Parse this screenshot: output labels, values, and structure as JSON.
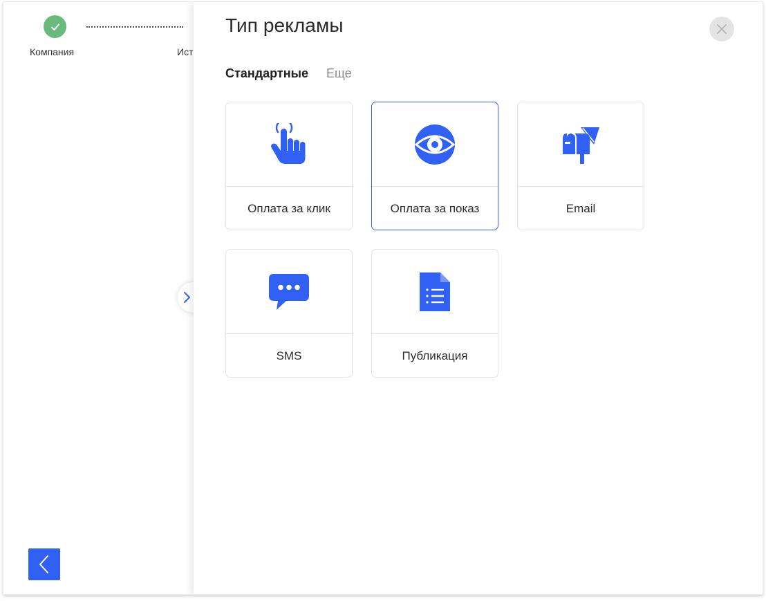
{
  "wizard": {
    "steps": [
      {
        "label": "Компания",
        "status": "done"
      },
      {
        "label": "Ист"
      }
    ]
  },
  "drawer": {
    "title": "Тип рекламы",
    "tabs": [
      {
        "label": "Стандартные",
        "active": true
      },
      {
        "label": "Еще",
        "active": false
      }
    ],
    "cards": [
      {
        "label": "Оплата за клик",
        "icon": "pointer-hand-icon",
        "selected": false
      },
      {
        "label": "Оплата за показ",
        "icon": "eye-icon",
        "selected": true
      },
      {
        "label": "Email",
        "icon": "mailbox-paper-plane-icon",
        "selected": false
      },
      {
        "label": "SMS",
        "icon": "chat-bubble-icon",
        "selected": false
      },
      {
        "label": "Публикация",
        "icon": "document-icon",
        "selected": false
      }
    ]
  },
  "colors": {
    "accent": "#3161f4",
    "success": "#6ab97d",
    "close_bg": "#e4e4e4"
  }
}
